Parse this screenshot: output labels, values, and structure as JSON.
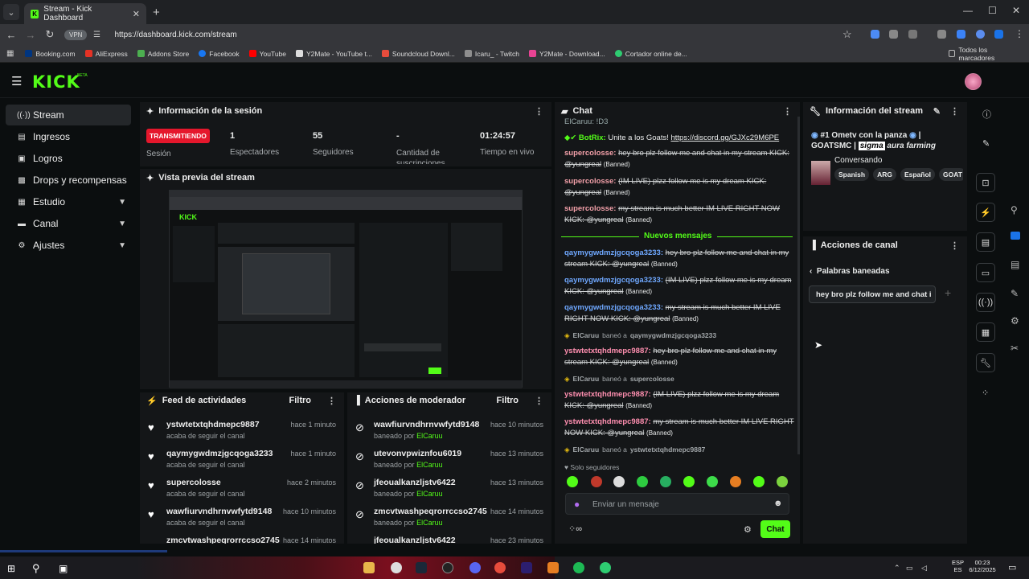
{
  "browser": {
    "tab_title": "Stream - Kick Dashboard",
    "url": "https://dashboard.kick.com/stream",
    "vpn": "VPN",
    "bookmarks": [
      "Booking.com",
      "AliExpress",
      "Addons Store",
      "Facebook",
      "YouTube",
      "Y2Mate - YouTube t...",
      "Soundcloud Downl...",
      "Icaru_ - Twitch",
      "Y2Mate - Download...",
      "Cortador online de..."
    ],
    "all_bookmarks": "Todos los marcadores"
  },
  "header": {
    "logo": "KICK",
    "beta": "BETA"
  },
  "sidebar": {
    "items": [
      {
        "label": "Stream"
      },
      {
        "label": "Ingresos"
      },
      {
        "label": "Logros"
      },
      {
        "label": "Drops y recompensas"
      },
      {
        "label": "Estudio"
      },
      {
        "label": "Canal"
      },
      {
        "label": "Ajustes"
      }
    ]
  },
  "session": {
    "title": "Información de la sesión",
    "live": "TRANSMITIENDO",
    "live_label": "Sesión",
    "stats": [
      {
        "value": "1",
        "label": "Espectadores"
      },
      {
        "value": "55",
        "label": "Seguidores"
      },
      {
        "value": "-",
        "label": "Cantidad de suscripciones"
      },
      {
        "value": "01:24:57",
        "label": "Tiempo en vivo"
      }
    ]
  },
  "preview": {
    "title": "Vista previa del stream"
  },
  "feed": {
    "title": "Feed de actividades",
    "filter": "Filtro",
    "items": [
      {
        "name": "ystwtetxtqhdmepc9887",
        "sub": "acaba de seguir el canal",
        "time": "hace 1 minuto"
      },
      {
        "name": "qaymygwdmzjgcqoga3233",
        "sub": "acaba de seguir el canal",
        "time": "hace 1 minuto"
      },
      {
        "name": "supercolosse",
        "sub": "acaba de seguir el canal",
        "time": "hace 2 minutos"
      },
      {
        "name": "wawfiurvndhrnvwfytd9148",
        "sub": "acaba de seguir el canal",
        "time": "hace 10 minutos"
      },
      {
        "name": "zmcvtwashpeqrorrccso2745",
        "sub": "",
        "time": "hace 14 minutos"
      }
    ]
  },
  "modactions": {
    "title": "Acciones de moderador",
    "filter": "Filtro",
    "items": [
      {
        "name": "wawfiurvndhrnvwfytd9148",
        "by": "baneado por",
        "mod": "ElCaruu",
        "time": "hace 10 minutos"
      },
      {
        "name": "utevonvpwiznfou6019",
        "by": "baneado por",
        "mod": "ElCaruu",
        "time": "hace 13 minutos"
      },
      {
        "name": "jfeoualkanzljstv6422",
        "by": "baneado por",
        "mod": "ElCaruu",
        "time": "hace 13 minutos"
      },
      {
        "name": "zmcvtwashpeqrorrccso2745",
        "by": "baneado por",
        "mod": "ElCaruu",
        "time": "hace 14 minutos"
      },
      {
        "name": "jfeoualkanzljstv6422",
        "by": "",
        "mod": "",
        "time": "hace 23 minutos"
      }
    ]
  },
  "chat": {
    "title": "Chat",
    "top_partial": "ElCaruu: !D3",
    "botrix_name": "BotRix:",
    "botrix_text": "Unite a los Goats!",
    "botrix_link": "https://discord.gg/GJXc29M6PE",
    "new_messages": "Nuevos mensajes",
    "banned_tag": "(Banned)",
    "messages_before": [
      {
        "user": "supercolosse:",
        "text": "hey bro plz follow me and chat in my stream KICK: @yungreal"
      },
      {
        "user": "supercolosse:",
        "text": "(IM LIVE) plzz follow me is my dream KICK: @yungreal"
      },
      {
        "user": "supercolosse:",
        "text": "my stream is much better IM LIVE RIGHT NOW KICK: @yungreal"
      }
    ],
    "messages_after": [
      {
        "user": "qaymygwdmzjgcqoga3233:",
        "text": "hey bro plz follow me and chat in my stream KICK: @yungreal"
      },
      {
        "user": "qaymygwdmzjgcqoga3233:",
        "text": "(IM LIVE) plzz follow me is my dream KICK: @yungreal"
      },
      {
        "user": "qaymygwdmzjgcqoga3233:",
        "text": "my stream is much better IM LIVE RIGHT NOW KICK: @yungreal"
      },
      {
        "sys_mod": "ElCaruu",
        "sys_text": "baneó a",
        "sys_target": "qaymygwdmzjgcqoga3233"
      },
      {
        "user": "ystwtetxtqhdmepc9887:",
        "text": "hey bro plz follow me and chat in my stream KICK: @yungreal"
      },
      {
        "sys_mod": "ElCaruu",
        "sys_text": "baneó a",
        "sys_target": "supercolosse"
      },
      {
        "user": "ystwtetxtqhdmepc9887:",
        "text": "(IM LIVE) plzz follow me is my dream KICK: @yungreal"
      },
      {
        "user": "ystwtetxtqhdmepc9887:",
        "text": "my stream is much better IM LIVE RIGHT NOW KICK: @yungreal"
      },
      {
        "sys_mod": "ElCaruu",
        "sys_text": "baneó a",
        "sys_target": "ystwtetxtqhdmepc9887"
      }
    ],
    "followers_only": "Solo seguidores",
    "placeholder": "Enviar un mensaje",
    "send": "Chat"
  },
  "streaminfo": {
    "title": "Información del stream",
    "stream_title": "#1 Ometv con la panza",
    "channel": "GOATSMC |",
    "sigma": "sigma",
    "aura": "aura farming",
    "category": "Conversando",
    "tags": [
      "Spanish",
      "ARG",
      "Español",
      "GOAT"
    ]
  },
  "channel_actions": {
    "title": "Acciones de canal",
    "sub": "Palabras baneadas",
    "input": "hey bro plz follow me and chat i"
  },
  "taskbar": {
    "lang": "ESP",
    "region": "ES",
    "time": "00:23",
    "date": "6/12/2025"
  }
}
